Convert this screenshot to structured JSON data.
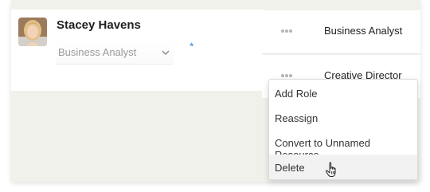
{
  "person": {
    "name": "Stacey Havens",
    "role_value": "Business Analyst",
    "required_marker": "*"
  },
  "roles": [
    {
      "label": "Business Analyst"
    },
    {
      "label": "Creative Director"
    }
  ],
  "menu": {
    "items": [
      "Add Role",
      "Reassign",
      "Convert to Unnamed Resource",
      "Delete"
    ],
    "hovered_item": "Delete"
  },
  "icons": {
    "more": "more-dots-icon",
    "chevron": "chevron-down-icon",
    "cursor": "hand-pointer-icon"
  },
  "colors": {
    "accent": "#3c8fd6",
    "hover_bg": "#f2f2f2"
  }
}
